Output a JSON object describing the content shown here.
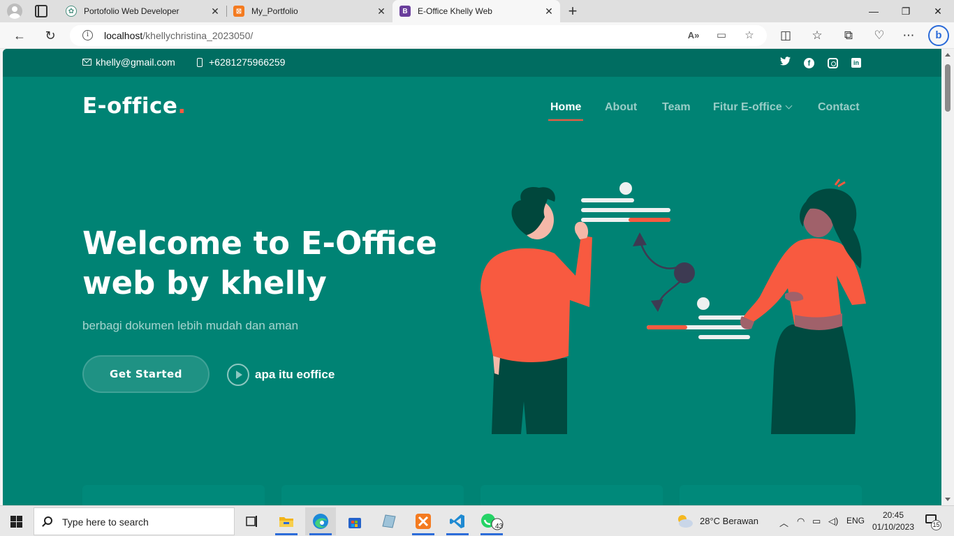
{
  "browser": {
    "tabs": [
      {
        "title": "Portofolio Web Developer",
        "favicon": "chatgpt-icon",
        "active": false
      },
      {
        "title": "My_Portfolio",
        "favicon": "xampp-icon",
        "active": false
      },
      {
        "title": "E-Office Khelly Web",
        "favicon": "bootstrap-icon",
        "active": true
      }
    ],
    "url_host": "localhost",
    "url_path": "/khellychristina_2023050/",
    "new_tab_label": "+",
    "bing_label": "b"
  },
  "page": {
    "topbar": {
      "email": "khelly@gmail.com",
      "phone": "+6281275966259",
      "socials": [
        "twitter-icon",
        "facebook-icon",
        "instagram-icon",
        "linkedin-icon"
      ]
    },
    "logo": {
      "text": "E-office",
      "dot": "."
    },
    "nav": {
      "home": "Home",
      "about": "About",
      "team": "Team",
      "fitur": "Fitur E-office",
      "contact": "Contact"
    },
    "hero": {
      "title_line1": "Welcome to E-Office",
      "title_line2": "web by khelly",
      "subtitle": "berbagi dokumen lebih mudah dan aman",
      "cta": "Get Started",
      "video_link": "apa itu eoffice"
    },
    "colors": {
      "primary": "#008374",
      "topbar": "#006d61",
      "accent": "#f85a40"
    }
  },
  "taskbar": {
    "search_placeholder": "Type here to search",
    "whatsapp_badge": "43",
    "weather": "28°C  Berawan",
    "language": "ENG",
    "time": "20:45",
    "date": "01/10/2023",
    "notifications": "15"
  }
}
